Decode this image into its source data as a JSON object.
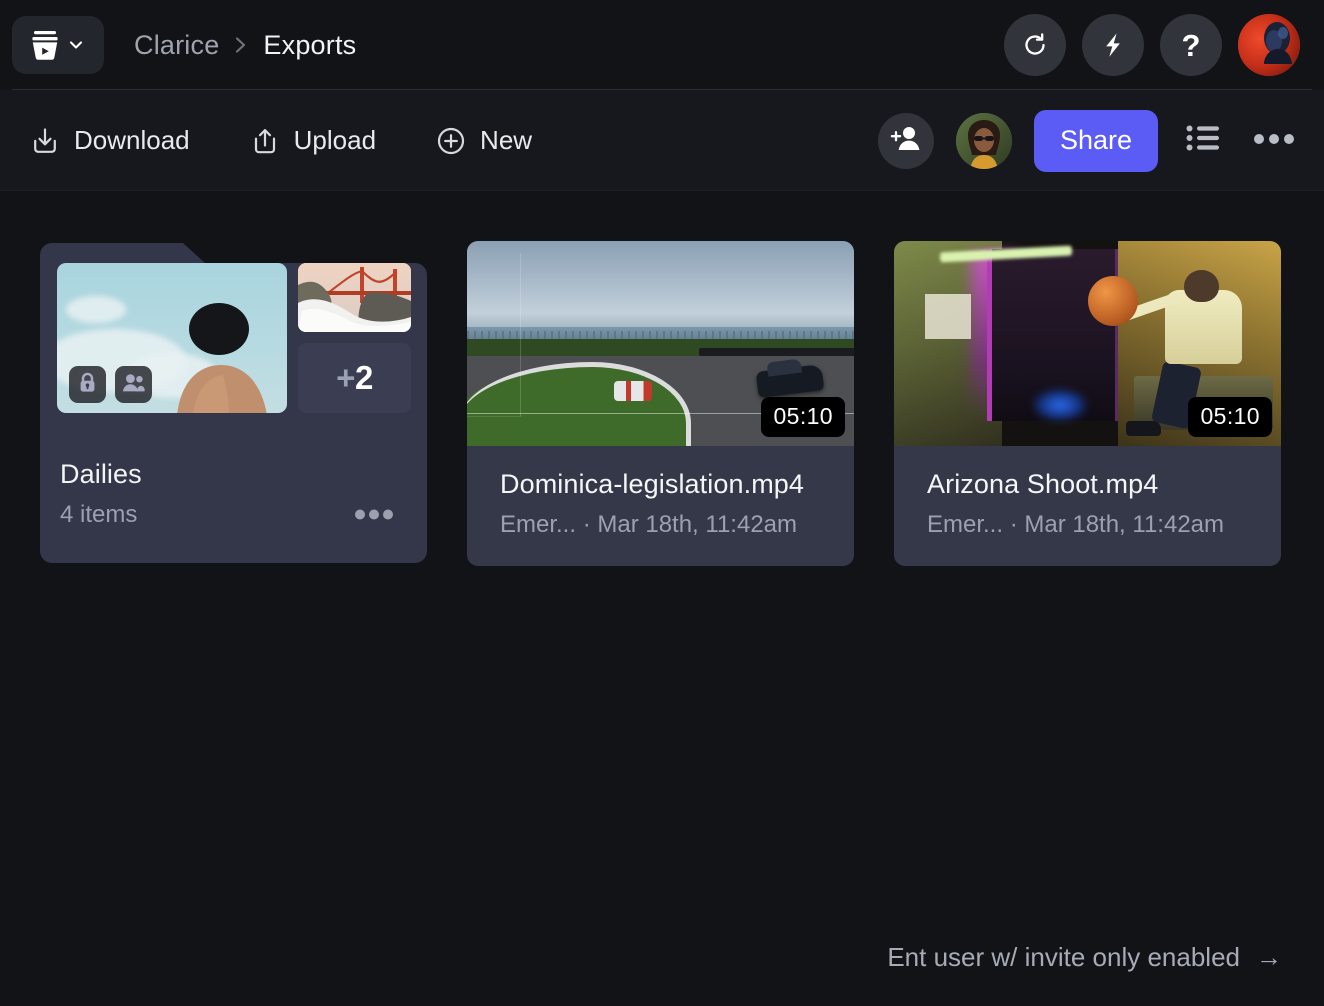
{
  "colors": {
    "app_background": "#121317",
    "toolbar_background": "#17181d",
    "accent_share": "#5b5bf5",
    "card_background": "#353848",
    "folder_card_background": "#343749",
    "muted_text": "#9aa0ae",
    "primary_text": "#f3f4f6",
    "circle_button": "#32343b"
  },
  "header": {
    "workspace_switcher": {
      "logo_icon": "frameio-bucket-play-icon",
      "chevron_icon": "chevron-down-icon"
    },
    "breadcrumb": {
      "parent": "Clarice",
      "separator": "›",
      "current": "Exports"
    },
    "actions": [
      {
        "name": "refresh-button",
        "icon": "refresh-icon"
      },
      {
        "name": "lightning-button",
        "icon": "lightning-bolt-icon"
      },
      {
        "name": "help-button",
        "icon": "question-mark-icon",
        "glyph": "?"
      }
    ],
    "account_avatar": "user-avatar"
  },
  "toolbar": {
    "download_label": "Download",
    "download_icon": "download-icon",
    "upload_label": "Upload",
    "upload_icon": "upload-icon",
    "new_label": "New",
    "new_icon": "plus-circle-icon",
    "add_collaborator_icon": "add-person-icon",
    "collaborator_avatar": "collaborator-avatar",
    "share_label": "Share",
    "view_toggle_icon": "list-view-icon",
    "more_options_icon": "more-horizontal-icon"
  },
  "content": {
    "folder_card": {
      "title": "Dailies",
      "item_count_label": "4 items",
      "overflow_count": "+2",
      "overflow_plus": "+",
      "overflow_number": "2",
      "badges": [
        {
          "name": "locked-badge",
          "icon": "lock-icon"
        },
        {
          "name": "shared-badge",
          "icon": "people-icon"
        }
      ],
      "more_icon": "more-horizontal-icon",
      "thumbnails": [
        "person-against-sky-thumbnail",
        "golden-gate-bridge-thumbnail"
      ]
    },
    "assets": [
      {
        "title": "Dominica-legislation.mp4",
        "owner": "Emer...",
        "separator": "·",
        "date": "Mar 18th, 11:42am",
        "subtitle": "Emer... · Mar 18th, 11:42am",
        "duration": "05:10",
        "thumbnail": "racetrack-car-thumbnail"
      },
      {
        "title": "Arizona Shoot.mp4",
        "owner": "Emer...",
        "separator": "·",
        "date": "Mar 18th, 11:42am",
        "subtitle": "Emer... · Mar 18th, 11:42am",
        "duration": "05:10",
        "thumbnail": "neon-basketball-thumbnail"
      }
    ]
  },
  "footer": {
    "note": "Ent user w/ invite only enabled",
    "arrow": "→"
  }
}
